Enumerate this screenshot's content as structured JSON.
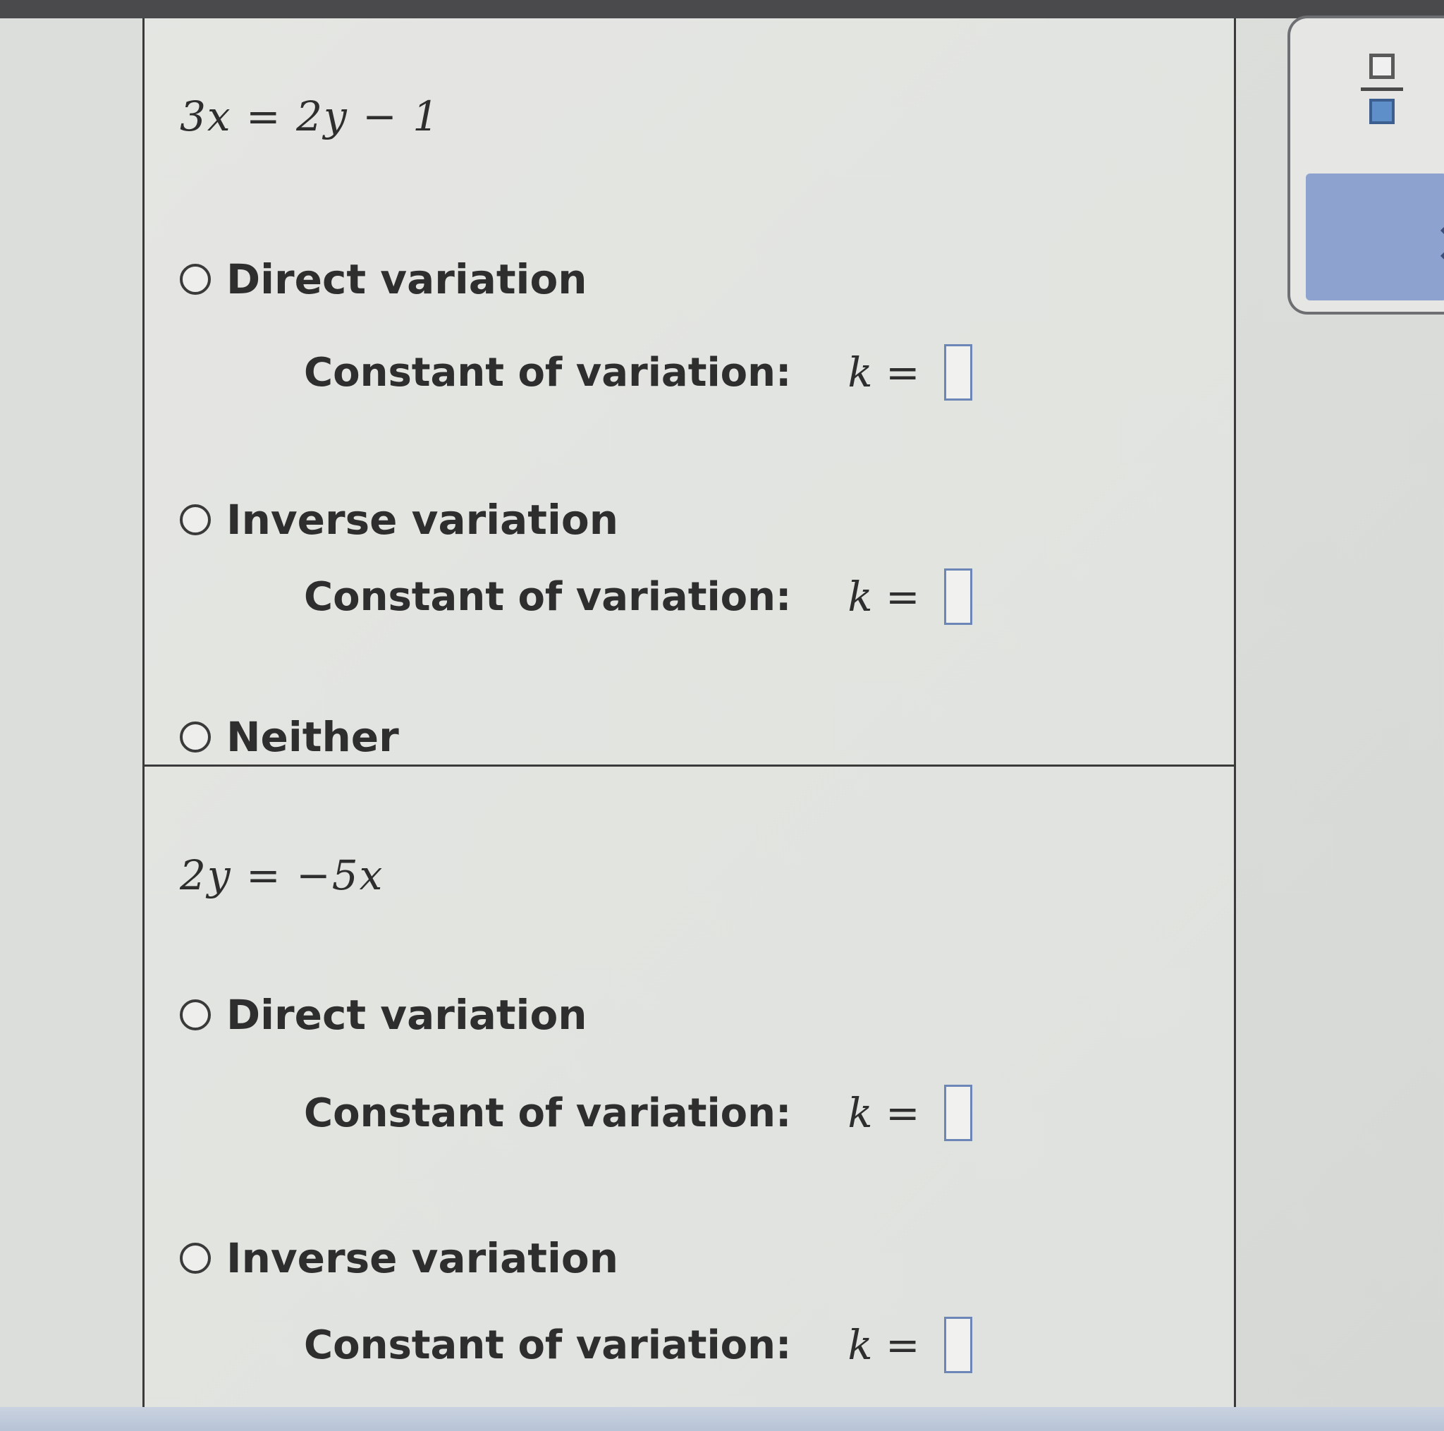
{
  "problems": [
    {
      "equation": "3x = 2y − 1",
      "options": {
        "direct": "Direct variation",
        "inverse": "Inverse variation",
        "neither": "Neither"
      },
      "constant_label": "Constant of variation:",
      "k_label": "k ="
    },
    {
      "equation": "2y = −5x",
      "options": {
        "direct": "Direct variation",
        "inverse": "Inverse variation"
      },
      "constant_label": "Constant of variation:",
      "k_label": "k ="
    }
  ],
  "toolbar": {
    "fraction_icon": "fraction-icon",
    "clear_icon": "close-icon",
    "clear_symbol": "×"
  },
  "colors": {
    "answer_box_border": "#6d86b8",
    "clear_button": "#8da2cf",
    "fraction_fill": "#5f8fc9"
  }
}
